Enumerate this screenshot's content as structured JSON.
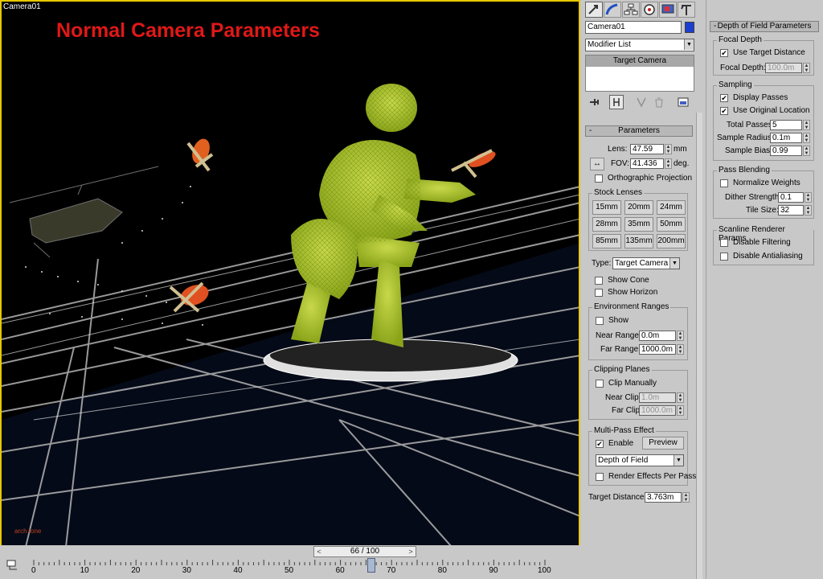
{
  "viewport": {
    "label": "Camera01",
    "title": "Normal Camera Parameters",
    "watermark": "arch tone"
  },
  "timeline": {
    "frame_display": "66 / 100",
    "current_frame": 66,
    "total_frames": 100,
    "prev_label": "<",
    "next_label": ">",
    "ticks": [
      "0",
      "10",
      "20",
      "30",
      "40",
      "50",
      "60",
      "70",
      "80",
      "90",
      "100"
    ]
  },
  "command_panel": {
    "tabs": [
      "create-icon",
      "modify-icon",
      "hierarchy-icon",
      "motion-icon",
      "display-icon",
      "utilities-icon"
    ],
    "object_name": "Camera01",
    "object_color": "#1a3fd0",
    "modifier_list": "Modifier List",
    "stack_item": "Target Camera"
  },
  "parameters": {
    "header": "Parameters",
    "lens_label": "Lens:",
    "lens_value": "47.59",
    "lens_unit": "mm",
    "fov_label": "FOV:",
    "fov_value": "41.436",
    "fov_unit": "deg.",
    "ortho_label": "Orthographic Projection",
    "stock_lenses_title": "Stock Lenses",
    "stock_lenses": [
      "15mm",
      "20mm",
      "24mm",
      "28mm",
      "35mm",
      "50mm",
      "85mm",
      "135mm",
      "200mm"
    ],
    "type_label": "Type:",
    "type_value": "Target Camera",
    "show_cone": "Show Cone",
    "show_horizon": "Show Horizon",
    "env_title": "Environment Ranges",
    "env_show": "Show",
    "near_range_label": "Near Range:",
    "near_range_value": "0.0m",
    "far_range_label": "Far Range:",
    "far_range_value": "1000.0m",
    "clip_title": "Clipping Planes",
    "clip_manually": "Clip Manually",
    "near_clip_label": "Near Clip:",
    "near_clip_value": "1.0m",
    "far_clip_label": "Far Clip:",
    "far_clip_value": "1000.0m",
    "multipass_title": "Multi-Pass Effect",
    "enable_label": "Enable",
    "preview_label": "Preview",
    "effect_value": "Depth of Field",
    "render_effects_label": "Render Effects Per Pass",
    "target_distance_label": "Target Distance:",
    "target_distance_value": "3.763m"
  },
  "dof": {
    "header": "Depth of Field Parameters",
    "focal_title": "Focal Depth",
    "use_target_distance": "Use Target Distance",
    "focal_depth_label": "Focal Depth:",
    "focal_depth_value": "100.0m",
    "sampling_title": "Sampling",
    "display_passes": "Display Passes",
    "use_original_location": "Use Original Location",
    "total_passes_label": "Total Passes:",
    "total_passes_value": "5",
    "sample_radius_label": "Sample Radius:",
    "sample_radius_value": "0.1m",
    "sample_bias_label": "Sample Bias:",
    "sample_bias_value": "0.99",
    "pass_blending_title": "Pass Blending",
    "normalize_weights": "Normalize Weights",
    "dither_label": "Dither Strength:",
    "dither_value": "0.1",
    "tile_label": "Tile Size:",
    "tile_value": "32",
    "scanline_title": "Scanline Renderer Params",
    "disable_filtering": "Disable Filtering",
    "disable_antialiasing": "Disable Antialiasing"
  },
  "checks": {
    "ortho": false,
    "show_cone": false,
    "show_horizon": false,
    "env_show": false,
    "clip_manually": false,
    "enable": true,
    "render_effects": false,
    "use_target_distance": true,
    "display_passes": true,
    "use_original_location": true,
    "normalize_weights": false,
    "disable_filtering": false,
    "disable_antialiasing": false
  },
  "check_mark": "✔"
}
